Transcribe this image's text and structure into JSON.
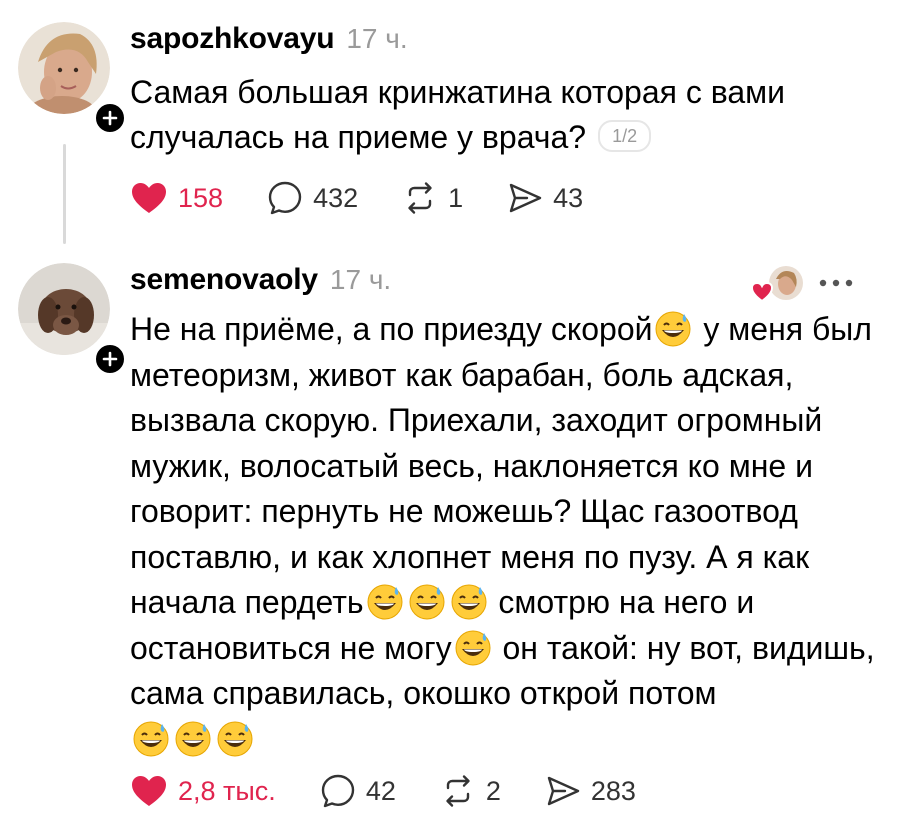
{
  "posts": [
    {
      "username": "sapozhkovayu",
      "time": "17 ч.",
      "text": "Самая большая кринжатина которая с вами случалась на приеме у врача?",
      "page_indicator": "1/2",
      "likes": "158",
      "comments": "432",
      "reposts": "1",
      "shares": "43"
    },
    {
      "username": "semenovaoly",
      "time": "17 ч.",
      "text_parts": [
        "Не на приёме,  а по приезду скорой",
        " у меня был метеоризм, живот как барабан, боль адская, вызвала скорую.  Приехали,  заходит огромный мужик, волосатый весь, наклоняется ко мне и говорит: пернуть не можешь? Щас газоотвод поставлю, и как хлопнет меня по пузу. А я как начала пердеть",
        " смотрю на него и остановиться не могу",
        " он такой: ну вот, видишь, сама справилась, окошко открой потом"
      ],
      "likes": "2,8 тыс.",
      "comments": "42",
      "reposts": "2",
      "shares": "283"
    }
  ],
  "icons": {
    "like": "heart-icon",
    "comment": "comment-bubble-icon",
    "repost": "repost-icon",
    "share": "send-icon",
    "more": "more-dots-icon",
    "follow": "plus-icon",
    "emoji": "grinning-sweat-emoji"
  },
  "colors": {
    "like_red": "#e0244e",
    "muted_gray": "#9a9a9a",
    "text": "#000000"
  }
}
